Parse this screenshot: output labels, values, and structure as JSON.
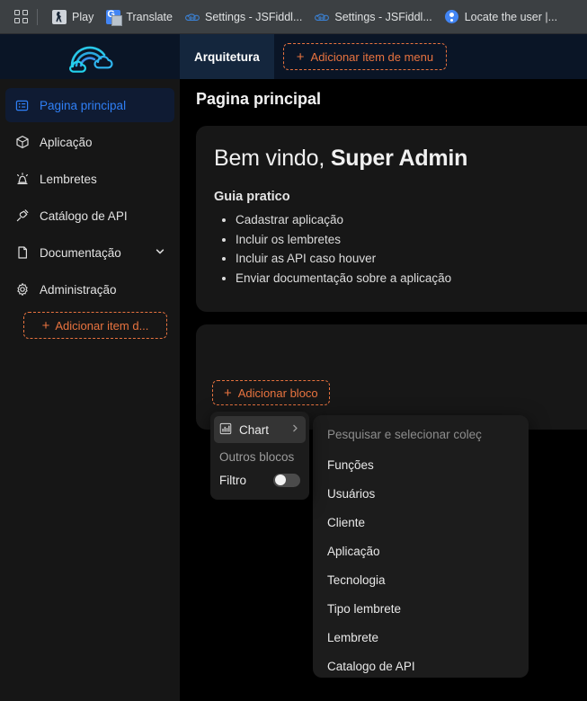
{
  "browser": {
    "apps_icon": "grid-apps-icon",
    "bookmarks": [
      {
        "label": "Play",
        "icon": "play-store-favicon"
      },
      {
        "label": "Translate",
        "icon": "google-translate-favicon"
      },
      {
        "label": "Settings - JSFiddl...",
        "icon": "jsfiddle-favicon"
      },
      {
        "label": "Settings - JSFiddl...",
        "icon": "jsfiddle-favicon"
      },
      {
        "label": "Locate the user |...",
        "icon": "location-favicon"
      }
    ]
  },
  "sidebar": {
    "logo": "rainbow-clouds-logo",
    "items": [
      {
        "label": "Pagina principal",
        "icon": "dashboard-icon",
        "active": true
      },
      {
        "label": "Aplicação",
        "icon": "cube-icon",
        "active": false
      },
      {
        "label": "Lembretes",
        "icon": "alarm-icon",
        "active": false
      },
      {
        "label": "Catálogo de API",
        "icon": "plug-icon",
        "active": false
      },
      {
        "label": "Documentação",
        "icon": "document-icon",
        "active": false,
        "chevron": "chevron-down-icon"
      },
      {
        "label": "Administração",
        "icon": "gear-icon",
        "active": false
      }
    ],
    "add_menu_item_label": "Adicionar item d...",
    "accent_color": "#e8733f"
  },
  "app": {
    "tabs": [
      {
        "label": "Arquitetura",
        "selected": true
      }
    ],
    "add_menu_item_label": "Adicionar item de menu",
    "page_title": "Pagina principal"
  },
  "welcome_card": {
    "greeting_plain": "Bem vindo, ",
    "greeting_bold": "Super Admin",
    "guide_title": "Guia pratico",
    "guide_items": [
      "Cadastrar aplicação",
      "Incluir os lembretes",
      "Incluir as API caso houver",
      "Enviar documentação sobre a aplicação"
    ]
  },
  "block_card": {
    "add_block_label": "Adicionar bloco",
    "ghost_add_label": ""
  },
  "context_menu": {
    "chart_label": "Chart",
    "chart_icon": "bar-chart-icon",
    "chart_arrow": "chevron-right-icon",
    "section_label": "Outros blocos",
    "filter_label": "Filtro",
    "filter_enabled": false
  },
  "submenu": {
    "search_placeholder": "Pesquisar e selecionar coleç",
    "items": [
      "Funções",
      "Usuários",
      "Cliente",
      "Aplicação",
      "Tecnologia",
      "Tipo lembrete",
      "Lembrete",
      "Catalogo de API"
    ]
  }
}
